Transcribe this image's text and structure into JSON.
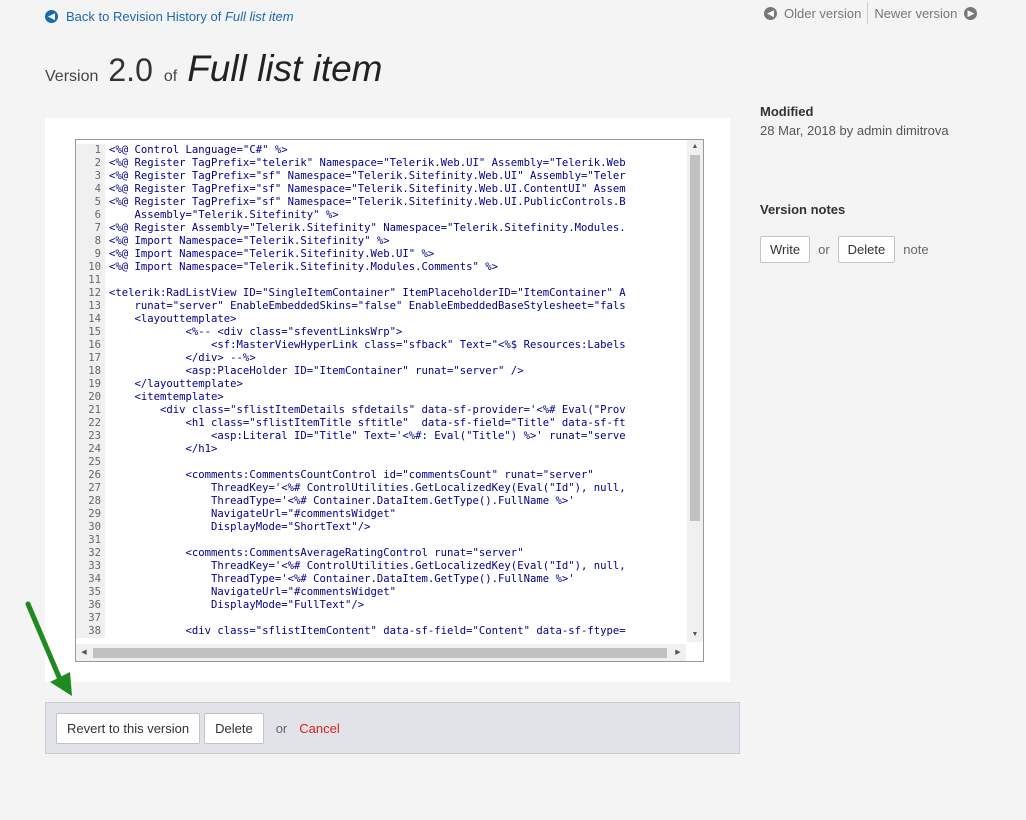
{
  "header": {
    "back_label": "Back to Revision History of",
    "back_item": "Full list item",
    "older_label": "Older version",
    "newer_label": "Newer version"
  },
  "title": {
    "prefix": "Version",
    "number": "2.0",
    "of": "of",
    "name": "Full list item"
  },
  "code": {
    "lines": [
      "<%@ Control Language=\"C#\" %>",
      "<%@ Register TagPrefix=\"telerik\" Namespace=\"Telerik.Web.UI\" Assembly=\"Telerik.Web",
      "<%@ Register TagPrefix=\"sf\" Namespace=\"Telerik.Sitefinity.Web.UI\" Assembly=\"Teler",
      "<%@ Register TagPrefix=\"sf\" Namespace=\"Telerik.Sitefinity.Web.UI.ContentUI\" Assem",
      "<%@ Register TagPrefix=\"sf\" Namespace=\"Telerik.Sitefinity.Web.UI.PublicControls.B",
      "    Assembly=\"Telerik.Sitefinity\" %>",
      "<%@ Register Assembly=\"Telerik.Sitefinity\" Namespace=\"Telerik.Sitefinity.Modules.",
      "<%@ Import Namespace=\"Telerik.Sitefinity\" %>",
      "<%@ Import Namespace=\"Telerik.Sitefinity.Web.UI\" %>",
      "<%@ Import Namespace=\"Telerik.Sitefinity.Modules.Comments\" %>",
      "",
      "<telerik:RadListView ID=\"SingleItemContainer\" ItemPlaceholderID=\"ItemContainer\" A",
      "    runat=\"server\" EnableEmbeddedSkins=\"false\" EnableEmbeddedBaseStylesheet=\"fals",
      "    <layouttemplate>",
      "            <%-- <div class=\"sfeventLinksWrp\">",
      "                <sf:MasterViewHyperLink class=\"sfback\" Text=\"<%$ Resources:Labels",
      "            </div> --%>",
      "            <asp:PlaceHolder ID=\"ItemContainer\" runat=\"server\" />",
      "    </layouttemplate>",
      "    <itemtemplate>",
      "        <div class=\"sflistItemDetails sfdetails\" data-sf-provider='<%# Eval(\"Prov",
      "            <h1 class=\"sflistItemTitle sftitle\"  data-sf-field=\"Title\" data-sf-ft",
      "                <asp:Literal ID=\"Title\" Text='<%#: Eval(\"Title\") %>' runat=\"serve",
      "            </h1>",
      "",
      "            <comments:CommentsCountControl id=\"commentsCount\" runat=\"server\"",
      "                ThreadKey='<%# ControlUtilities.GetLocalizedKey(Eval(\"Id\"), null,",
      "                ThreadType='<%# Container.DataItem.GetType().FullName %>'",
      "                NavigateUrl=\"#commentsWidget\"",
      "                DisplayMode=\"ShortText\"/>",
      "",
      "            <comments:CommentsAverageRatingControl runat=\"server\"",
      "                ThreadKey='<%# ControlUtilities.GetLocalizedKey(Eval(\"Id\"), null,",
      "                ThreadType='<%# Container.DataItem.GetType().FullName %>'",
      "                NavigateUrl=\"#commentsWidget\"",
      "                DisplayMode=\"FullText\"/>",
      "",
      "            <div class=\"sflistItemContent\" data-sf-field=\"Content\" data-sf-ftype="
    ]
  },
  "actions": {
    "revert_label": "Revert to this version",
    "delete_label": "Delete",
    "or_label": "or",
    "cancel_label": "Cancel"
  },
  "sidebar": {
    "modified_label": "Modified",
    "modified_value": "28 Mar, 2018 by admin dimitrova",
    "notes_label": "Version notes",
    "write_label": "Write",
    "or_label": "or",
    "delete_label": "Delete",
    "note_label": "note"
  },
  "colors": {
    "link": "#1a6ab0",
    "cancel": "#d9231d",
    "arrow": "#1f8a1f"
  }
}
